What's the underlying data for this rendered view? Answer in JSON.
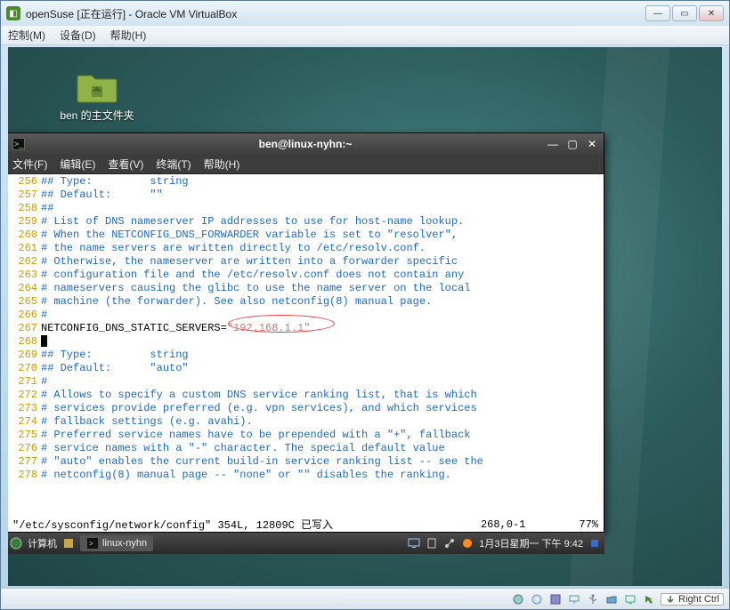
{
  "win": {
    "title": "openSuse [正在运行] - Oracle VM VirtualBox",
    "menu": {
      "control": "控制(M)",
      "device": "设备(D)",
      "help": "帮助(H)"
    }
  },
  "desktop": {
    "folder_label": "ben 的主文件夹"
  },
  "terminal": {
    "title": "ben@linux-nyhn:~",
    "menu": {
      "file": "文件(F)",
      "edit": "编辑(E)",
      "view": "查看(V)",
      "term": "终端(T)",
      "help": "帮助(H)"
    },
    "lines": [
      {
        "n": "256",
        "text": "## Type:         string"
      },
      {
        "n": "257",
        "text": "## Default:      \"\""
      },
      {
        "n": "258",
        "text": "##"
      },
      {
        "n": "259",
        "text": "# List of DNS nameserver IP addresses to use for host-name lookup."
      },
      {
        "n": "260",
        "text": "# When the NETCONFIG_DNS_FORWARDER variable is set to \"resolver\","
      },
      {
        "n": "261",
        "text": "# the name servers are written directly to /etc/resolv.conf."
      },
      {
        "n": "262",
        "text": "# Otherwise, the nameserver are written into a forwarder specific"
      },
      {
        "n": "263",
        "text": "# configuration file and the /etc/resolv.conf does not contain any"
      },
      {
        "n": "264",
        "text": "# nameservers causing the glibc to use the name server on the local"
      },
      {
        "n": "265",
        "text": "# machine (the forwarder). See also netconfig(8) manual page."
      },
      {
        "n": "266",
        "text": "#"
      },
      {
        "n": "267",
        "plain": "NETCONFIG_DNS_STATIC_SERVERS=",
        "val": "\"192.168.1.1\""
      },
      {
        "n": "268",
        "cursor": true
      },
      {
        "n": "269",
        "text": "## Type:         string"
      },
      {
        "n": "270",
        "text": "## Default:      \"auto\""
      },
      {
        "n": "271",
        "text": "#"
      },
      {
        "n": "272",
        "text": "# Allows to specify a custom DNS service ranking list, that is which"
      },
      {
        "n": "273",
        "text": "# services provide preferred (e.g. vpn services), and which services"
      },
      {
        "n": "274",
        "text": "# fallback settings (e.g. avahi)."
      },
      {
        "n": "275",
        "text": "# Preferred service names have to be prepended with a \"+\", fallback"
      },
      {
        "n": "276",
        "text": "# service names with a \"-\" character. The special default value"
      },
      {
        "n": "277",
        "text": "# \"auto\" enables the current build-in service ranking list -- see the"
      },
      {
        "n": "278",
        "text": "# netconfig(8) manual page -- \"none\" or \"\" disables the ranking."
      }
    ],
    "status": {
      "path": "\"/etc/sysconfig/network/config\" 354L, 12809C 已写入",
      "pos": "268,0-1",
      "pct": "77%"
    }
  },
  "taskbar": {
    "computer": "计算机",
    "task1": "linux-nyhn",
    "clock": "1月3日星期一 下午  9:42"
  },
  "vb_status": {
    "hostkey": "Right Ctrl"
  }
}
